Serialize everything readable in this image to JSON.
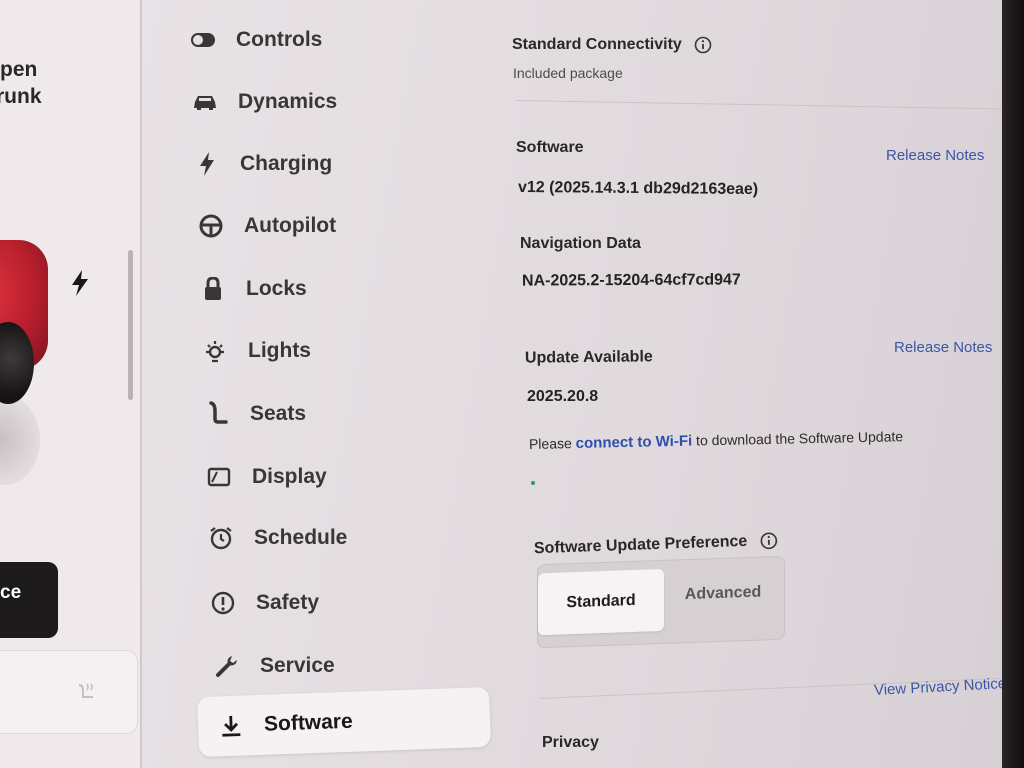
{
  "left_panel": {
    "trunk_line1": "pen",
    "trunk_line2": "runk",
    "button_label": "ce"
  },
  "menu": {
    "items": [
      {
        "label": "Controls",
        "icon": "toggle-icon"
      },
      {
        "label": "Dynamics",
        "icon": "car-icon"
      },
      {
        "label": "Charging",
        "icon": "bolt-icon"
      },
      {
        "label": "Autopilot",
        "icon": "steering-wheel-icon"
      },
      {
        "label": "Locks",
        "icon": "lock-icon"
      },
      {
        "label": "Lights",
        "icon": "light-bulb-icon"
      },
      {
        "label": "Seats",
        "icon": "seat-icon"
      },
      {
        "label": "Display",
        "icon": "display-icon"
      },
      {
        "label": "Schedule",
        "icon": "alarm-clock-icon"
      },
      {
        "label": "Safety",
        "icon": "alert-circle-icon"
      },
      {
        "label": "Service",
        "icon": "wrench-icon"
      },
      {
        "label": "Software",
        "icon": "download-icon",
        "active": true
      }
    ]
  },
  "connectivity": {
    "title": "Standard Connectivity",
    "subtitle": "Included package"
  },
  "software": {
    "title": "Software",
    "version": "v12 (2025.14.3.1 db29d2163eae)",
    "release_notes": "Release Notes"
  },
  "navigation": {
    "title": "Navigation Data",
    "value": "NA-2025.2-15204-64cf7cd947"
  },
  "update": {
    "title": "Update Available",
    "version": "2025.20.8",
    "release_notes": "Release Notes",
    "message_prefix": "Please ",
    "message_link": "connect to Wi-Fi",
    "message_suffix": " to download the Software Update"
  },
  "preference": {
    "title": "Software Update Preference",
    "options": [
      "Standard",
      "Advanced"
    ],
    "selected": "Standard"
  },
  "privacy": {
    "link": "View Privacy Notice",
    "title": "Privacy"
  },
  "colors": {
    "accent_link": "#3b55a8",
    "progress": "#2f9c55",
    "car_red": "#c8202d"
  }
}
